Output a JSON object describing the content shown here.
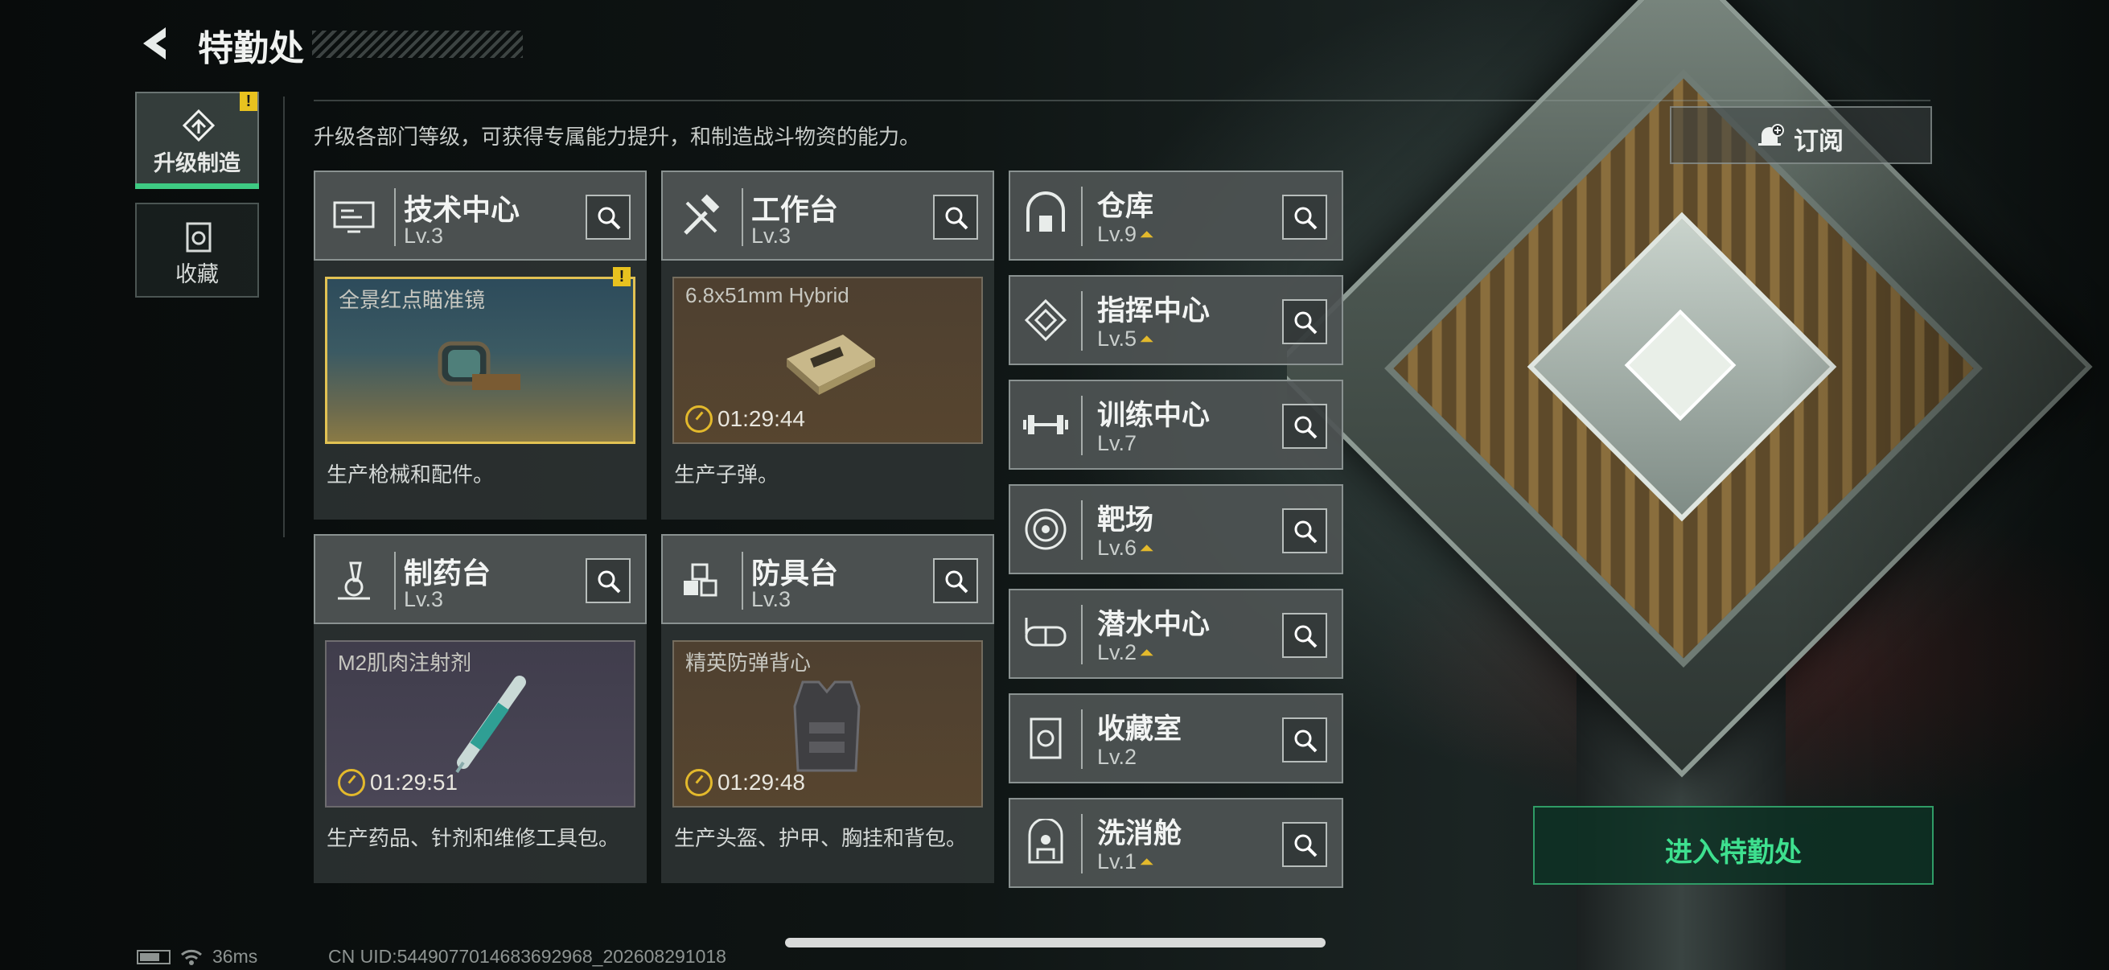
{
  "header": {
    "title": "特勤处"
  },
  "subtitle": "升级各部门等级，可获得专属能力提升，和制造战斗物资的能力。",
  "nav": [
    {
      "label": "升级制造",
      "active": true,
      "alert": "!"
    },
    {
      "label": "收藏",
      "active": false
    }
  ],
  "subscribe_label": "订阅",
  "stations": [
    {
      "name": "技术中心",
      "level": "Lv.3",
      "product": "全景红点瞄准镜",
      "timer": "",
      "desc": "生产枪械和配件。",
      "alert": "!"
    },
    {
      "name": "工作台",
      "level": "Lv.3",
      "product": "6.8x51mm Hybrid",
      "timer": "01:29:44",
      "desc": "生产子弹。"
    },
    {
      "name": "制药台",
      "level": "Lv.3",
      "product": "M2肌肉注射剂",
      "timer": "01:29:51",
      "desc": "生产药品、针剂和维修工具包。"
    },
    {
      "name": "防具台",
      "level": "Lv.3",
      "product": "精英防弹背心",
      "timer": "01:29:48",
      "desc": "生产头盔、护甲、胸挂和背包。"
    }
  ],
  "facilities": [
    {
      "name": "仓库",
      "level": "Lv.9",
      "upgradable": true
    },
    {
      "name": "指挥中心",
      "level": "Lv.5",
      "upgradable": true
    },
    {
      "name": "训练中心",
      "level": "Lv.7",
      "upgradable": false
    },
    {
      "name": "靶场",
      "level": "Lv.6",
      "upgradable": true
    },
    {
      "name": "潜水中心",
      "level": "Lv.2",
      "upgradable": true
    },
    {
      "name": "收藏室",
      "level": "Lv.2",
      "upgradable": false
    },
    {
      "name": "洗消舱",
      "level": "Lv.1",
      "upgradable": true
    }
  ],
  "enter_label": "进入特勤处",
  "status": {
    "ping": "36ms",
    "uid": "CN UID:5449077014683692968_202608291018"
  },
  "colors": {
    "accent_green": "#3ee08f",
    "alert_yellow": "#e8c21f",
    "upgrade_gold": "#e3b92c"
  }
}
